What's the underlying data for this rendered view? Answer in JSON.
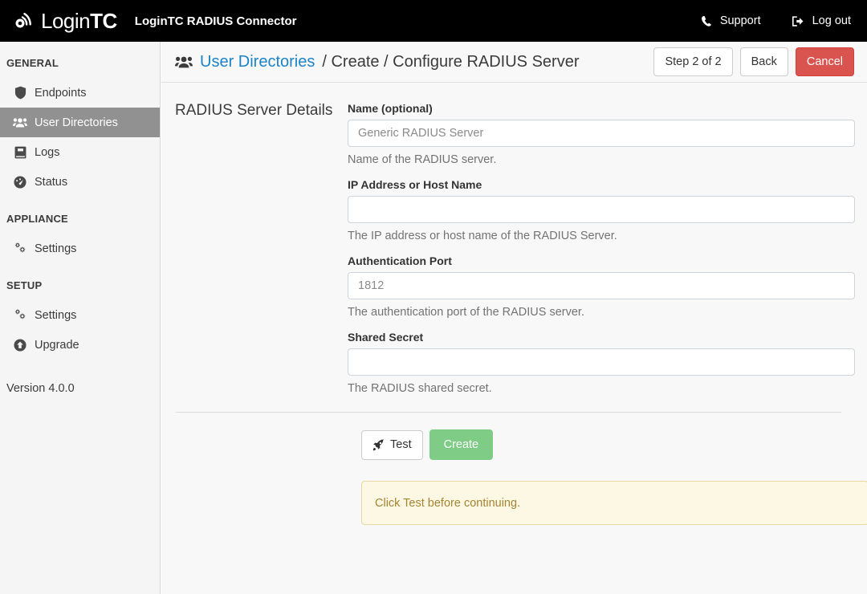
{
  "navbar": {
    "brand_login": "Login",
    "brand_tc": "TC",
    "app_title": "LoginTC RADIUS Connector",
    "support_label": "Support",
    "logout_label": "Log out",
    "background": "#000000"
  },
  "sidebar": {
    "sections": [
      {
        "heading": "GENERAL",
        "items": [
          {
            "label": "Endpoints",
            "icon": "shield-icon",
            "active": false
          },
          {
            "label": "User Directories",
            "icon": "users-icon",
            "active": true
          },
          {
            "label": "Logs",
            "icon": "book-icon",
            "active": false
          },
          {
            "label": "Status",
            "icon": "tachometer-icon",
            "active": false
          }
        ]
      },
      {
        "heading": "APPLIANCE",
        "items": [
          {
            "label": "Settings",
            "icon": "cogs-icon",
            "active": false
          }
        ]
      },
      {
        "heading": "SETUP",
        "items": [
          {
            "label": "Settings",
            "icon": "cogs-icon",
            "active": false
          },
          {
            "label": "Upgrade",
            "icon": "arrow-up-circle-icon",
            "active": false
          }
        ]
      }
    ],
    "version": "Version 4.0.0",
    "active_background": "#919191"
  },
  "page": {
    "breadcrumb_link": "User Directories",
    "breadcrumb_tail": "/ Create / Configure RADIUS Server",
    "link_color": "#1a84c7",
    "buttons": {
      "step": "Step 2 of 2",
      "back": "Back",
      "cancel": "Cancel",
      "cancel_color": "#d9534f"
    }
  },
  "form": {
    "section_title": "RADIUS Server Details",
    "fields": [
      {
        "label": "Name (optional)",
        "value": "",
        "placeholder": "Generic RADIUS Server",
        "help": "Name of the RADIUS server."
      },
      {
        "label": "IP Address or Host Name",
        "value": "",
        "placeholder": "",
        "help": "The IP address or host name of the RADIUS Server."
      },
      {
        "label": "Authentication Port",
        "value": "",
        "placeholder": "1812",
        "help": "The authentication port of the RADIUS server."
      },
      {
        "label": "Shared Secret",
        "value": "",
        "placeholder": "",
        "help": "The RADIUS shared secret."
      }
    ],
    "test_label": "Test",
    "create_label": "Create",
    "create_color": "#7fcc87",
    "alert_text": "Click Test before continuing.",
    "alert_background": "#fcf8e3",
    "alert_text_color": "#a58432"
  }
}
